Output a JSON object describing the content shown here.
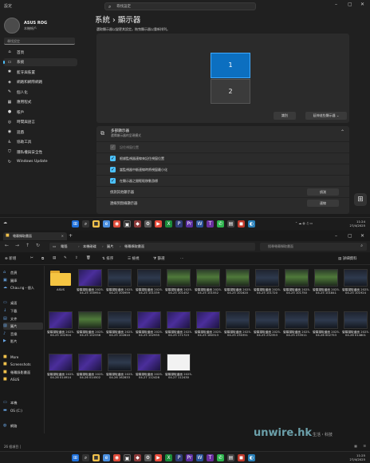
{
  "settings": {
    "window_title": "設定",
    "search_placeholder": "尋找設定",
    "profile": {
      "name": "ASUS ROG",
      "subtitle": "本機帳戶"
    },
    "sidebar_search": "尋找設定",
    "nav": [
      {
        "label": "首頁",
        "icon": "home-icon",
        "glyph": "⌂"
      },
      {
        "label": "系統",
        "icon": "monitor-icon",
        "glyph": "▭",
        "active": true
      },
      {
        "label": "藍牙與裝置",
        "icon": "bluetooth-icon",
        "glyph": "✱"
      },
      {
        "label": "網路和網際網路",
        "icon": "wifi-icon",
        "glyph": "◈"
      },
      {
        "label": "個人化",
        "icon": "brush-icon",
        "glyph": "✎"
      },
      {
        "label": "應用程式",
        "icon": "apps-icon",
        "glyph": "▦"
      },
      {
        "label": "帳戶",
        "icon": "person-icon",
        "glyph": "●"
      },
      {
        "label": "時間與語言",
        "icon": "globe-icon",
        "glyph": "◎"
      },
      {
        "label": "遊戲",
        "icon": "gamepad-icon",
        "glyph": "◉"
      },
      {
        "label": "協助工具",
        "icon": "accessibility-icon",
        "glyph": "♿"
      },
      {
        "label": "隱私權與安全性",
        "icon": "shield-icon",
        "glyph": "⛉"
      },
      {
        "label": "Windows Update",
        "icon": "update-icon",
        "glyph": "↻"
      }
    ],
    "breadcrumb": {
      "parent": "系統",
      "sep": "›",
      "current": "顯示器"
    },
    "arrange_hint": "選取顯示器以變更其設定。拖曳顯示器以重新排列。",
    "monitors": [
      "1",
      "2"
    ],
    "identify": "識別",
    "detect": "延伸這些顯示器",
    "multi": {
      "title": "多部顯示器",
      "desc": "選擇顯示器的呈現模式",
      "options": [
        {
          "label": "記住視窗位置",
          "checked": true,
          "disabled": true
        },
        {
          "label": "根據監視器連線來記住視窗位置",
          "checked": true,
          "disabled": false
        },
        {
          "label": "當監視器中斷連線時將視窗最小化",
          "checked": true,
          "disabled": false
        },
        {
          "label": "在顯示器之間輕鬆移動游標",
          "checked": true,
          "disabled": false
        }
      ],
      "detect_label": "偵測其他顯示器",
      "detect_btn": "偵測",
      "wireless_label": "連線到無線顯示器",
      "wireless_btn": "連線"
    }
  },
  "taskbar1": {
    "weather": "☁",
    "time": "11:24",
    "date": "27/4/2025"
  },
  "explorer": {
    "tab": "螢幕擷取畫面",
    "breadcrumb": [
      "電腦",
      "本機磁碟",
      "圖片",
      "螢幕擷取畫面"
    ],
    "search_placeholder": "搜尋螢幕擷取畫面",
    "toolbar": [
      "新增",
      "排序",
      "檢視",
      "篩選",
      "…",
      "詳細資料"
    ],
    "tree": [
      {
        "label": "首頁",
        "icon": "home-icon",
        "glyph": "⌂"
      },
      {
        "label": "圖庫",
        "icon": "gallery-icon",
        "glyph": "▣"
      },
      {
        "label": "Chau.ng - 個人",
        "icon": "cloud-icon",
        "glyph": "☁"
      },
      {
        "label": "桌面",
        "icon": "desktop-icon",
        "glyph": "▭"
      },
      {
        "label": "下載",
        "icon": "download-icon",
        "glyph": "↓"
      },
      {
        "label": "文件",
        "icon": "documents-icon",
        "glyph": "▤"
      },
      {
        "label": "圖片",
        "icon": "pictures-icon",
        "glyph": "▨",
        "selected": true
      },
      {
        "label": "音樂",
        "icon": "music-icon",
        "glyph": "♪"
      },
      {
        "label": "影片",
        "icon": "video-icon",
        "glyph": "▶"
      },
      {
        "label": "More",
        "icon": "folder-icon",
        "glyph": "■"
      },
      {
        "label": "Screenshots",
        "icon": "folder-icon",
        "glyph": "■"
      },
      {
        "label": "螢幕錄影畫面",
        "icon": "folder-icon",
        "glyph": "■"
      },
      {
        "label": "ASUS",
        "icon": "folder-icon",
        "glyph": "■"
      },
      {
        "label": "本機",
        "icon": "pc-icon",
        "glyph": "▭"
      },
      {
        "label": "OS (C:)",
        "icon": "drive-icon",
        "glyph": "▬"
      },
      {
        "label": "網路",
        "icon": "network-icon",
        "glyph": "◍"
      }
    ],
    "files": [
      {
        "name": "ASUS",
        "folder": true
      },
      {
        "name": "螢幕擷取畫面 2025-04-25 100954",
        "style": "purple"
      },
      {
        "name": "螢幕擷取畫面 2025-04-25 100959",
        "style": "dark"
      },
      {
        "name": "螢幕擷取畫面 2025-04-25 101339",
        "style": "dark"
      },
      {
        "name": "螢幕擷取畫面 2025-04-25 101452",
        "style": "green"
      },
      {
        "name": "螢幕擷取畫面 2025-04-25 101552",
        "style": "green"
      },
      {
        "name": "螢幕擷取畫面 2025-04-25 101620",
        "style": "green"
      },
      {
        "name": "螢幕擷取畫面 2025-04-25 101720",
        "style": "dark"
      },
      {
        "name": "螢幕擷取畫面 2025-04-25 101750",
        "style": "green"
      },
      {
        "name": "螢幕擷取畫面 2025-04-25 101841",
        "style": "green"
      },
      {
        "name": "螢幕擷取畫面 2025-04-25 101924",
        "style": "dark"
      },
      {
        "name": "螢幕擷取畫面 2025-04-25 102304",
        "style": "purple"
      },
      {
        "name": "螢幕擷取畫面 2025-04-25 102338",
        "style": "green"
      },
      {
        "name": "螢幕擷取畫面 2025-04-25 102810",
        "style": "dark"
      },
      {
        "name": "螢幕擷取畫面 2025-04-25 102935",
        "style": "purple"
      },
      {
        "name": "螢幕擷取畫面 2025-04-25 171723",
        "style": "purple"
      },
      {
        "name": "螢幕擷取畫面 2025-04-25 180313",
        "style": "purple"
      },
      {
        "name": "螢幕擷取畫面 2025-04-25 230351",
        "style": "dark"
      },
      {
        "name": "螢幕擷取畫面 2025-04-25 232353",
        "style": "dark"
      },
      {
        "name": "螢幕擷取畫面 2025-04-25 233511",
        "style": "dark"
      },
      {
        "name": "螢幕擷取畫面 2025-04-26 002753",
        "style": "dark"
      },
      {
        "name": "螢幕擷取畫面 2025-04-26 014801",
        "style": "dark"
      },
      {
        "name": "螢幕擷取畫面 2025-04-26 014914",
        "style": "purple"
      },
      {
        "name": "螢幕擷取畫面 2025-04-26 014502",
        "style": "purple"
      },
      {
        "name": "螢幕擷取畫面 2025-04-26 162833",
        "style": "dark"
      },
      {
        "name": "螢幕擷取畫面 2025-04-27 112426",
        "style": "purple"
      },
      {
        "name": "螢幕擷取畫面 2025-04-27 112430",
        "style": "white"
      }
    ],
    "status": "26 個項目 │"
  },
  "taskbar2": {
    "time": "11:25",
    "date": "27/4/2025"
  },
  "watermark": {
    "brand": "unwire.hk",
    "tagline": "生活・科技"
  }
}
